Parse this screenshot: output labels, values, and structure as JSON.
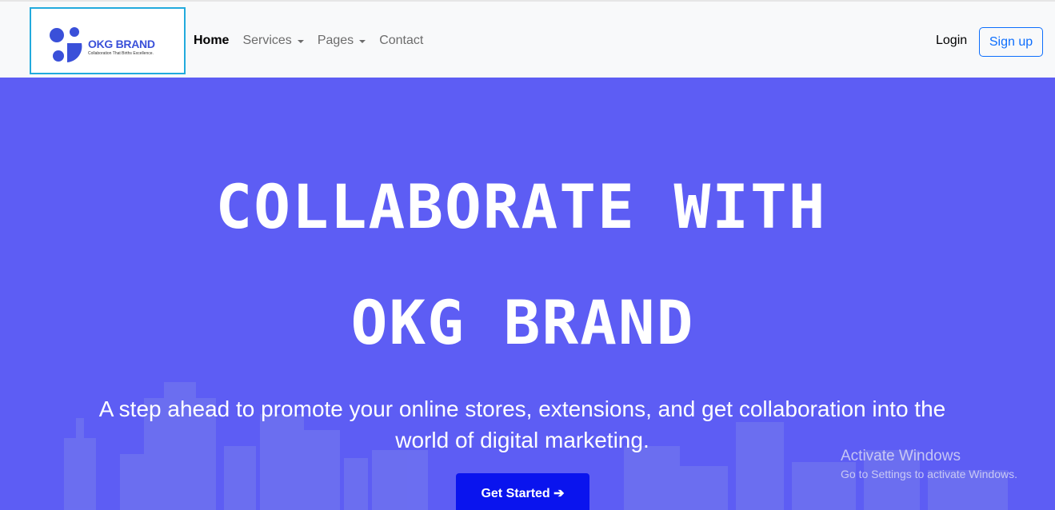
{
  "brand": {
    "name": "OKG BRAND",
    "tagline": "Collaboration That Births Excellence.",
    "colors": {
      "logo": "#3a50d9",
      "logo_border": "#22aadd"
    }
  },
  "nav": {
    "items": [
      {
        "label": "Home",
        "active": true,
        "dropdown": false
      },
      {
        "label": "Services",
        "active": false,
        "dropdown": true
      },
      {
        "label": "Pages",
        "active": false,
        "dropdown": true
      },
      {
        "label": "Contact",
        "active": false,
        "dropdown": false
      }
    ],
    "login_label": "Login",
    "signup_label": "Sign up"
  },
  "hero": {
    "headline_line1": "COLLABORATE WITH",
    "headline_line2": "OKG BRAND",
    "subtext": "A step ahead to promote your online stores, extensions, and get collaboration into the world of digital marketing.",
    "cta_label": "Get Started ➔",
    "colors": {
      "background": "#5d5df4",
      "cta": "#0a14ee"
    }
  },
  "watermark": {
    "title": "Activate Windows",
    "subtitle": "Go to Settings to activate Windows."
  }
}
